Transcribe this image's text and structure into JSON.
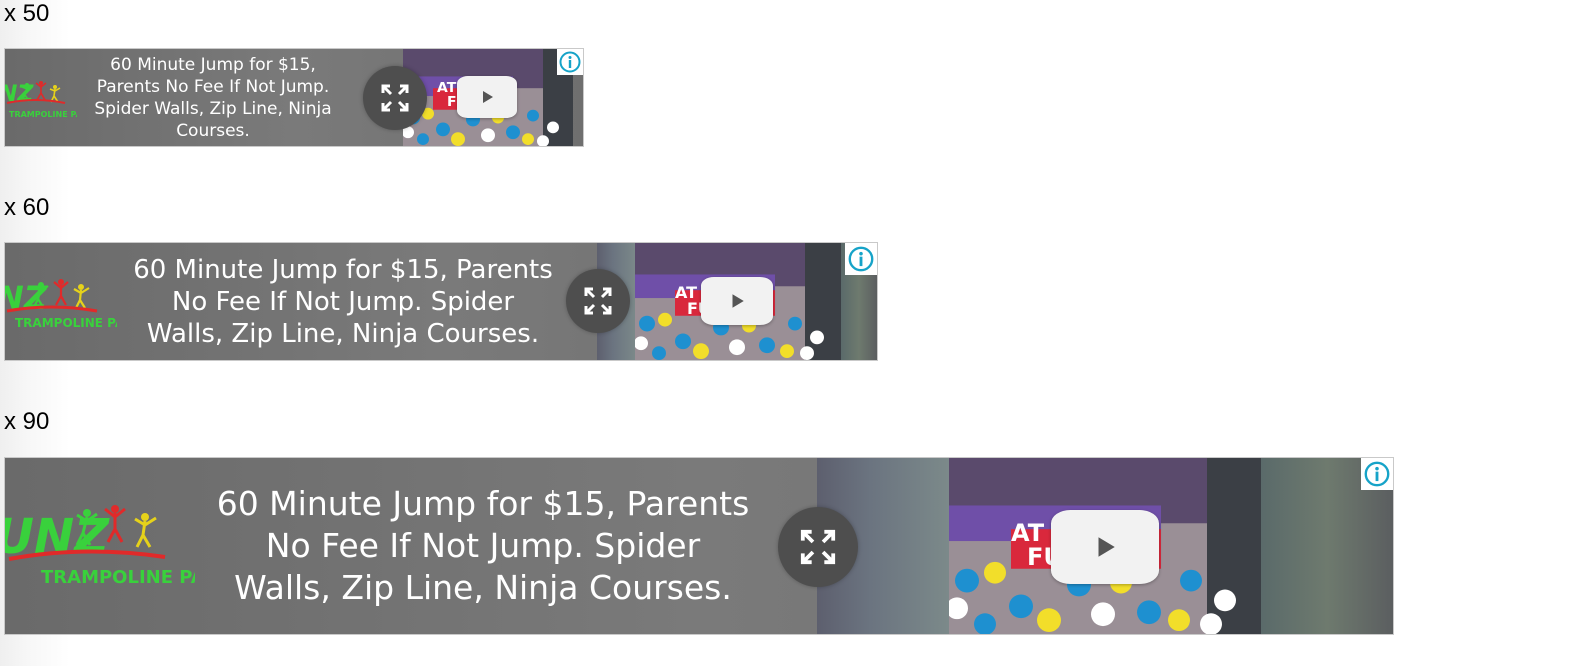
{
  "ads": [
    {
      "size_label": "x 50",
      "headline": "60 Minute Jump for $15, Parents No Fee If Not Jump. Spider Walls, Zip Line, Ninja Courses.",
      "logo_text": "TRAMPOLINE PARK",
      "logo_letters": "NZ"
    },
    {
      "size_label": "x 60",
      "headline": "60 Minute Jump for $15, Parents No Fee If Not Jump. Spider Walls, Zip Line, Ninja Courses.",
      "logo_text": "TRAMPOLINE PARK",
      "logo_letters": "NZ"
    },
    {
      "size_label": "x 90",
      "headline": "60 Minute Jump for $15, Parents No Fee If Not Jump. Spider Walls, Zip Line, Ninja Courses.",
      "logo_text": "TRAMPOLINE PARK",
      "logo_letters": "UNZ"
    }
  ],
  "thumbnail_text": {
    "line1": "AT    NS",
    "line2": "FU"
  },
  "icons": {
    "expand": "expand-icon",
    "play": "play-icon",
    "info": "info-icon"
  },
  "colors": {
    "logo_green": "#39d13c",
    "logo_red": "#e02a2a",
    "logo_yellow": "#e6d21a",
    "info_blue": "#16a3c8",
    "ad_gray": "#707070"
  }
}
